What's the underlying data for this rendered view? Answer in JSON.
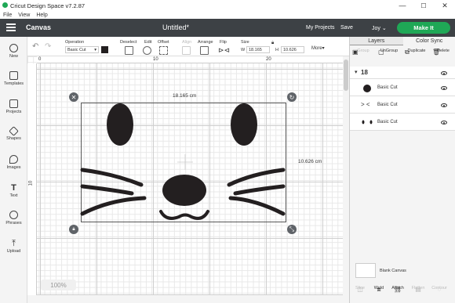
{
  "window": {
    "title": "Cricut Design Space  v7.2.87",
    "min": "—",
    "max": "☐",
    "close": "✕"
  },
  "menu": [
    "File",
    "View",
    "Help"
  ],
  "header": {
    "section": "Canvas",
    "doc_title": "Untitled*",
    "my_projects": "My Projects",
    "save": "Save",
    "user": "Joy",
    "make_it": "Make It"
  },
  "toolbar": {
    "operation_label": "Operation",
    "operation_value": "Basic Cut",
    "deselect": "Deselect",
    "edit": "Edit",
    "offset": "Offset",
    "align": "Align",
    "arrange": "Arrange",
    "flip": "Flip",
    "size": "Size",
    "w_label": "W",
    "w_value": "18.165",
    "h_label": "H",
    "h_value": "10.626",
    "more": "More▾"
  },
  "leftbar": [
    "New",
    "Templates",
    "Projects",
    "Shapes",
    "Images",
    "Text",
    "Phrases",
    "Upload"
  ],
  "rulers": {
    "h": [
      "0",
      "10",
      "20"
    ],
    "v": [
      "10"
    ]
  },
  "canvas": {
    "width_dim": "18.165 cm",
    "height_dim": "10.626 cm",
    "zoom": "100%"
  },
  "right": {
    "tabs": [
      "Layers",
      "Color Sync"
    ],
    "actions": [
      "Group",
      "UnGroup",
      "Duplicate",
      "Delete"
    ],
    "group_count": "18",
    "layers": [
      {
        "name": "Basic Cut"
      },
      {
        "name": "Basic Cut"
      },
      {
        "name": "Basic Cut"
      }
    ],
    "blank_canvas": "Blank Canvas",
    "bottom_tools": [
      "Slice",
      "Weld",
      "Attach",
      "Flatten",
      "Contour"
    ]
  },
  "colors": {
    "header": "#3d4145",
    "accent": "#1fa856",
    "shape": "#231f20"
  }
}
